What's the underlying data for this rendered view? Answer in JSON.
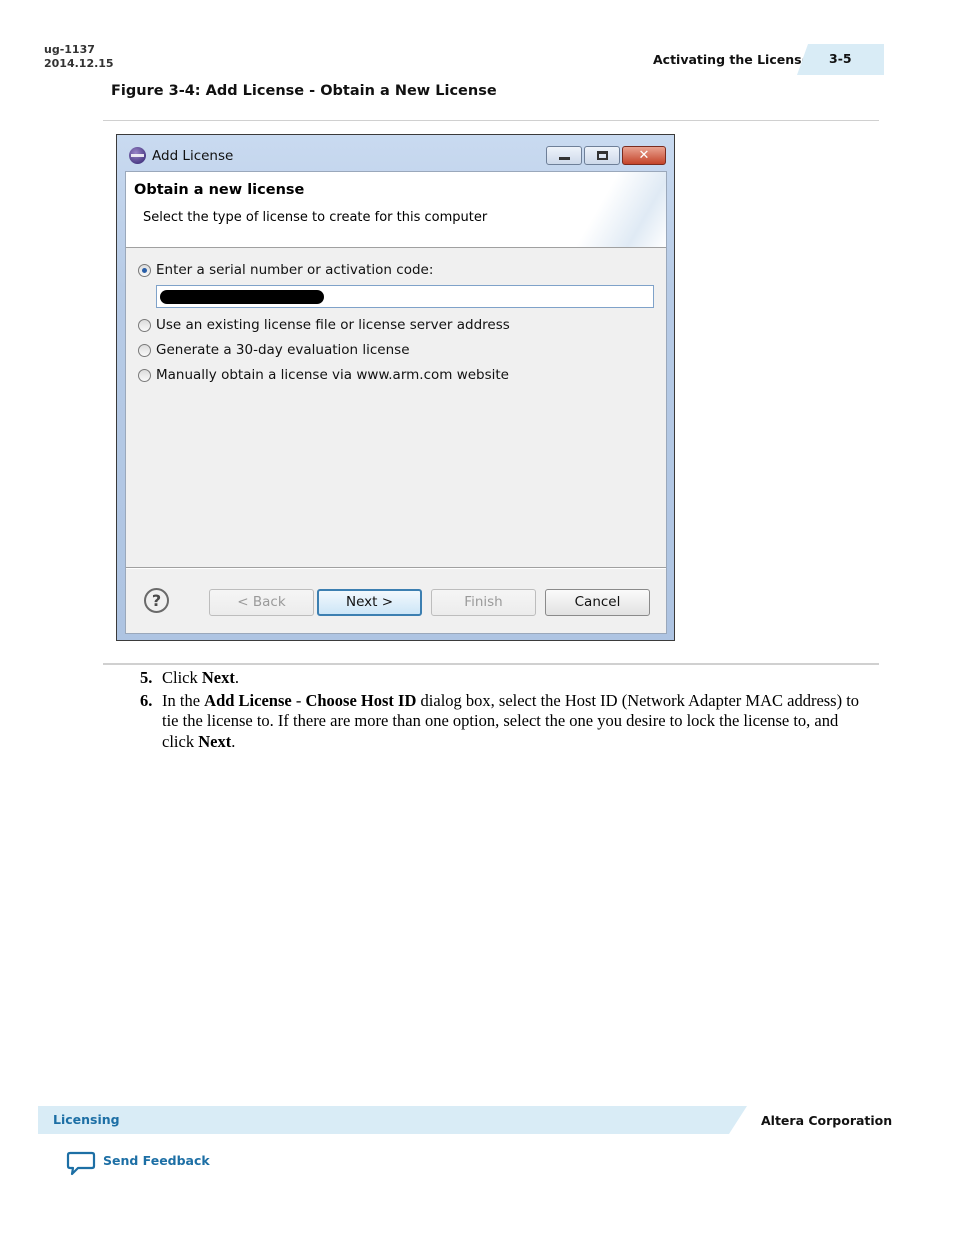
{
  "header": {
    "doc_id": "ug-1137",
    "doc_date": "2014.12.15",
    "section_title": "Activating the License",
    "page_number": "3-5"
  },
  "figure": {
    "caption": "Figure 3-4: Add License - Obtain a New License"
  },
  "dialog": {
    "title": "Add License",
    "heading": "Obtain a new license",
    "description": "Select the type of license to create for this computer",
    "options": [
      {
        "label": "Enter a serial number or activation code:",
        "checked": true
      },
      {
        "label": "Use an existing license file or license server address",
        "checked": false
      },
      {
        "label": "Generate a 30-day evaluation license",
        "checked": false
      },
      {
        "label": "Manually obtain a license via www.arm.com website",
        "checked": false
      }
    ],
    "buttons": {
      "back": "< Back",
      "next": "Next >",
      "finish": "Finish",
      "cancel": "Cancel"
    },
    "help_glyph": "?",
    "window_icons": [
      "minimize-icon",
      "maximize-icon",
      "close-icon"
    ]
  },
  "steps": [
    {
      "number": "5.",
      "parts": [
        {
          "text": "Click ",
          "bold": false
        },
        {
          "text": "Next",
          "bold": true
        },
        {
          "text": ".",
          "bold": false
        }
      ]
    },
    {
      "number": "6.",
      "parts": [
        {
          "text": "In the ",
          "bold": false
        },
        {
          "text": "Add License",
          "bold": true
        },
        {
          "text": " - ",
          "bold": false
        },
        {
          "text": "Choose Host ID",
          "bold": true
        },
        {
          "text": " dialog box, select the Host ID (Network Adapter MAC address) to tie the license to. If there are more than one option, select the one you desire to lock the license to, and click ",
          "bold": false
        },
        {
          "text": "Next",
          "bold": true
        },
        {
          "text": ".",
          "bold": false
        }
      ]
    }
  ],
  "footer": {
    "section": "Licensing",
    "company": "Altera Corporation",
    "feedback": "Send Feedback"
  },
  "colors": {
    "accent_blue": "#1d6fa5",
    "band_light_blue": "#d9ecf6"
  }
}
